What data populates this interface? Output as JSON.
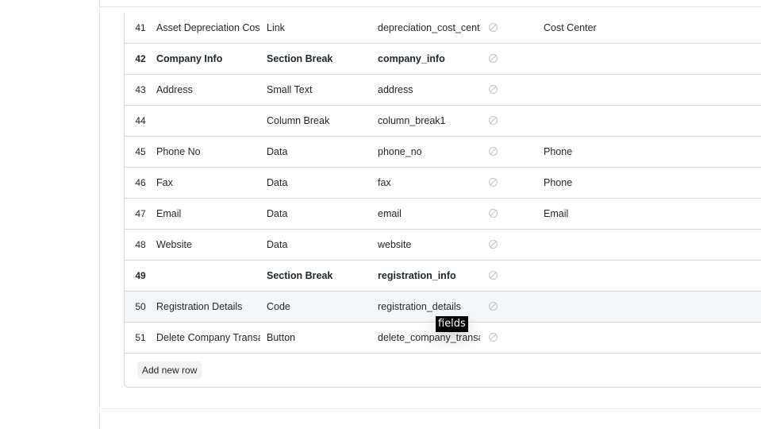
{
  "grid": {
    "rows": [
      {
        "idx": "41",
        "label": "Asset Depreciation Cost",
        "type": "Link",
        "fieldname": "depreciation_cost_center",
        "options": "Cost Center",
        "bold": false
      },
      {
        "idx": "42",
        "label": "Company Info",
        "type": "Section Break",
        "fieldname": "company_info",
        "options": "",
        "bold": true
      },
      {
        "idx": "43",
        "label": "Address",
        "type": "Small Text",
        "fieldname": "address",
        "options": "",
        "bold": false
      },
      {
        "idx": "44",
        "label": "",
        "type": "Column Break",
        "fieldname": "column_break1",
        "options": "",
        "bold": false
      },
      {
        "idx": "45",
        "label": "Phone No",
        "type": "Data",
        "fieldname": "phone_no",
        "options": "Phone",
        "bold": false
      },
      {
        "idx": "46",
        "label": "Fax",
        "type": "Data",
        "fieldname": "fax",
        "options": "Phone",
        "bold": false
      },
      {
        "idx": "47",
        "label": "Email",
        "type": "Data",
        "fieldname": "email",
        "options": "Email",
        "bold": false
      },
      {
        "idx": "48",
        "label": "Website",
        "type": "Data",
        "fieldname": "website",
        "options": "",
        "bold": false
      },
      {
        "idx": "49",
        "label": "",
        "type": "Section Break",
        "fieldname": "registration_info",
        "options": "",
        "bold": true
      },
      {
        "idx": "50",
        "label": "Registration Details",
        "type": "Code",
        "fieldname": "registration_details",
        "options": "",
        "bold": false,
        "hover": true
      },
      {
        "idx": "51",
        "label": "Delete Company Transactions",
        "type": "Button",
        "fieldname": "delete_company_transactions",
        "options": "",
        "bold": false
      }
    ],
    "add_row_label": "Add new row"
  },
  "tooltip": {
    "text": "fields"
  },
  "icons": {
    "mandatory": "ban-icon"
  }
}
